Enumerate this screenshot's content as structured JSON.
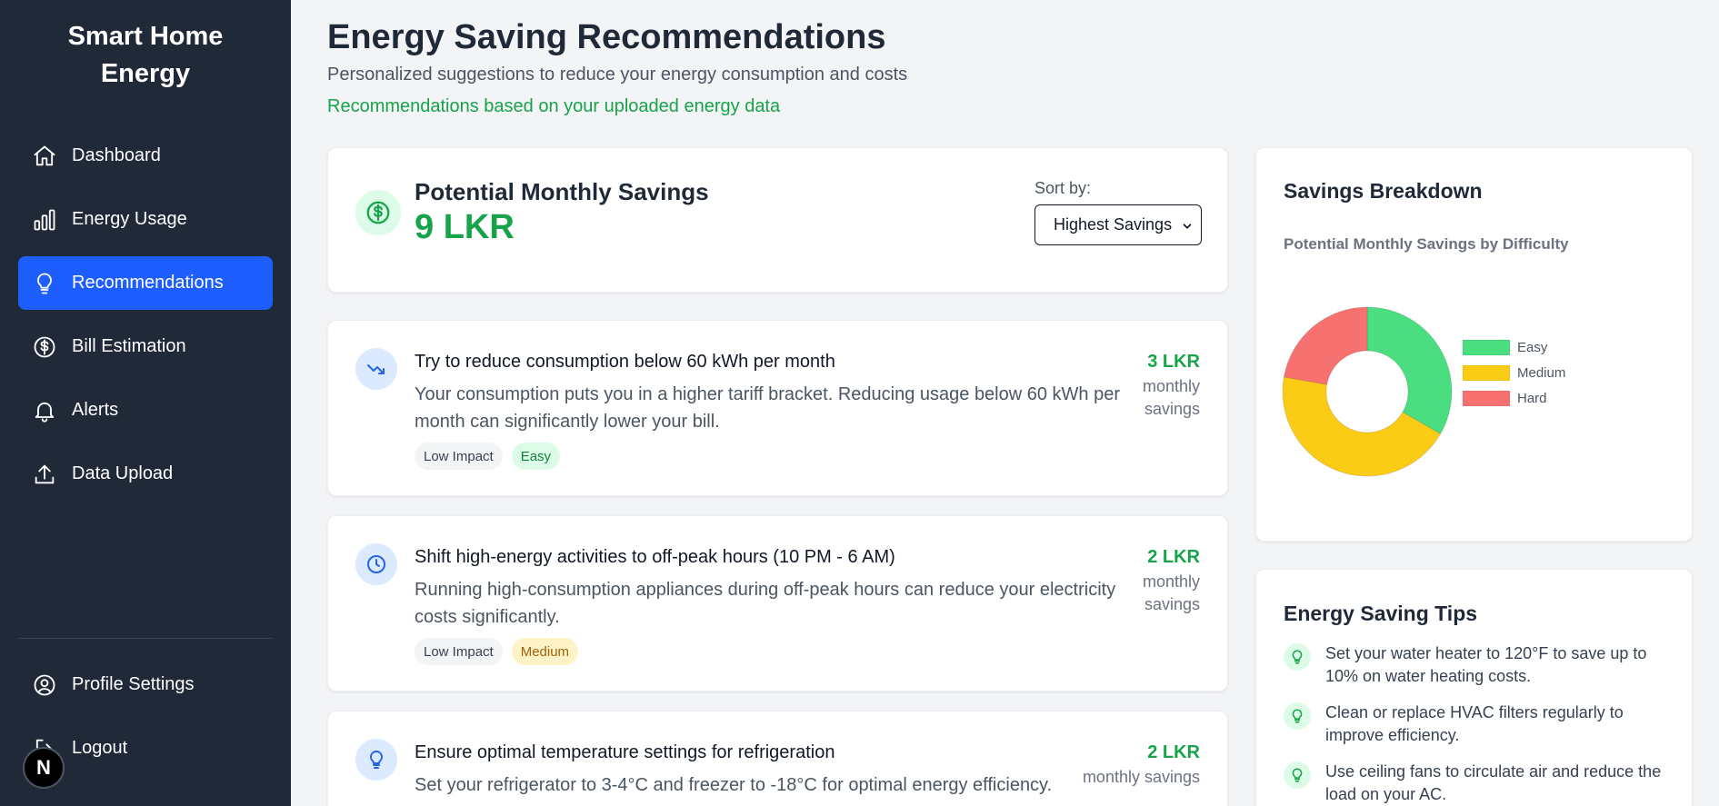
{
  "sidebar": {
    "brand": "Smart Home Energy",
    "items": [
      {
        "label": "Dashboard",
        "icon": "home-icon"
      },
      {
        "label": "Energy Usage",
        "icon": "bar-chart-icon"
      },
      {
        "label": "Recommendations",
        "icon": "lightbulb-icon",
        "active": true
      },
      {
        "label": "Bill Estimation",
        "icon": "dollar-circle-icon"
      },
      {
        "label": "Alerts",
        "icon": "bell-icon"
      },
      {
        "label": "Data Upload",
        "icon": "upload-icon"
      }
    ],
    "bottom": [
      {
        "label": "Profile Settings",
        "icon": "user-circle-icon"
      },
      {
        "label": "Logout",
        "icon": "logout-icon"
      }
    ],
    "badge": "N"
  },
  "header": {
    "title": "Energy Saving Recommendations",
    "subtitle": "Personalized suggestions to reduce your energy consumption and costs",
    "data_note": "Recommendations based on your uploaded energy data"
  },
  "summary": {
    "label": "Potential Monthly Savings",
    "value": "9 LKR",
    "sort_label": "Sort by:",
    "sort_selected": "Highest Savings"
  },
  "recommendations": [
    {
      "icon": "trending-down-icon",
      "title": "Try to reduce consumption below 60 kWh per month",
      "description": "Your consumption puts you in a higher tariff bracket. Reducing usage below 60 kWh per month can significantly lower your bill.",
      "amount": "3 LKR",
      "unit": "monthly savings",
      "impact": "Low Impact",
      "difficulty": "Easy"
    },
    {
      "icon": "clock-icon",
      "title": "Shift high-energy activities to off-peak hours (10 PM - 6 AM)",
      "description": "Running high-consumption appliances during off-peak hours can reduce your electricity costs significantly.",
      "amount": "2 LKR",
      "unit": "monthly savings",
      "impact": "Low Impact",
      "difficulty": "Medium"
    },
    {
      "icon": "lightbulb-icon",
      "title": "Ensure optimal temperature settings for refrigeration",
      "description": "Set your refrigerator to 3-4°C and freezer to -18°C for optimal energy efficiency.",
      "amount": "2 LKR",
      "unit": "monthly savings"
    }
  ],
  "breakdown": {
    "title": "Savings Breakdown",
    "subtitle": "Potential Monthly Savings by Difficulty"
  },
  "chart_data": {
    "type": "pie",
    "title": "Potential Monthly Savings by Difficulty",
    "categories": [
      "Easy",
      "Medium",
      "Hard"
    ],
    "values": [
      3,
      4,
      2
    ],
    "colors": [
      "#4ade80",
      "#facc15",
      "#f87171"
    ],
    "legend": "right"
  },
  "tips": {
    "title": "Energy Saving Tips",
    "items": [
      "Set your water heater to 120°F to save up to 10% on water heating costs.",
      "Clean or replace HVAC filters regularly to improve efficiency.",
      "Use ceiling fans to circulate air and reduce the load on your AC."
    ]
  }
}
